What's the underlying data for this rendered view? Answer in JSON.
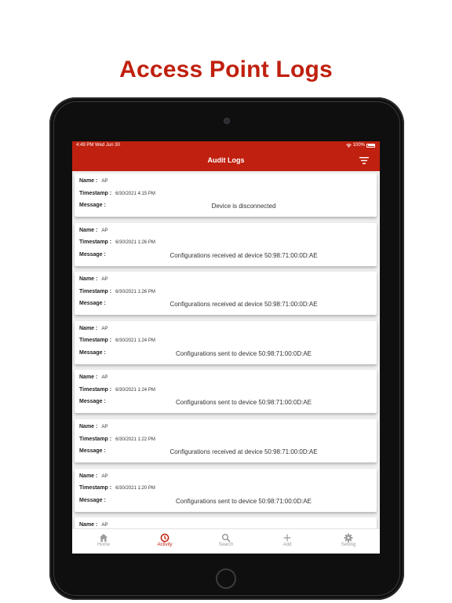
{
  "headline": "Access Point Logs",
  "status_bar": {
    "time": "4:49 PM  Wed Jun 30",
    "battery": "100%"
  },
  "nav": {
    "title": "Audit Logs",
    "filter_icon": "filter-icon"
  },
  "field_labels": {
    "name": "Name :",
    "timestamp": "Timestamp :",
    "message": "Message :"
  },
  "logs": [
    {
      "name": "AP",
      "timestamp": "6/30/2021 4:15 PM",
      "message": "Device is disconnected"
    },
    {
      "name": "AP",
      "timestamp": "6/30/2021 1:26 PM",
      "message": "Configurations received at device 50:98:71:00:0D:AE"
    },
    {
      "name": "AP",
      "timestamp": "6/30/2021 1:26 PM",
      "message": "Configurations received at device 50:98:71:00:0D:AE"
    },
    {
      "name": "AP",
      "timestamp": "6/30/2021 1:24 PM",
      "message": "Configurations sent to device 50:98:71:00:0D:AE"
    },
    {
      "name": "AP",
      "timestamp": "6/30/2021 1:24 PM",
      "message": "Configurations sent to device 50:98:71:00:0D:AE"
    },
    {
      "name": "AP",
      "timestamp": "6/30/2021 1:22 PM",
      "message": "Configurations received at device 50:98:71:00:0D:AE"
    },
    {
      "name": "AP",
      "timestamp": "6/30/2021 1:20 PM",
      "message": "Configurations sent to device 50:98:71:00:0D:AE"
    },
    {
      "name": "AP",
      "timestamp": "",
      "message": ""
    }
  ],
  "tabs": [
    {
      "label": "Home",
      "icon": "home-icon",
      "active": false
    },
    {
      "label": "Activity",
      "icon": "clock-icon",
      "active": true
    },
    {
      "label": "Search",
      "icon": "search-icon",
      "active": false
    },
    {
      "label": "Add",
      "icon": "plus-icon",
      "active": false
    },
    {
      "label": "Setting",
      "icon": "gear-icon",
      "active": false
    }
  ],
  "colors": {
    "brand": "#c0200f",
    "tab_inactive": "#9a9a9a",
    "background": "#eeeeee"
  }
}
